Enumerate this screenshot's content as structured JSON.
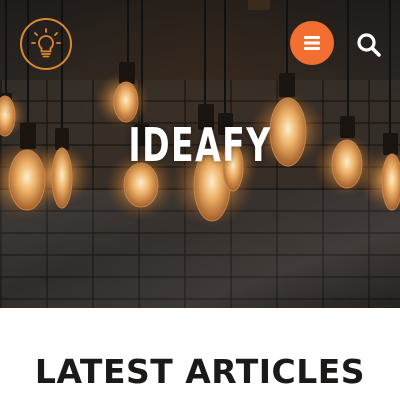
{
  "header": {
    "logo_icon": "lightbulb-icon",
    "menu_icon": "hamburger-menu-icon",
    "search_icon": "search-icon",
    "accent_color": "#f26f31",
    "logo_color": "#d8892f"
  },
  "hero": {
    "site_title": "IDEAFY"
  },
  "main": {
    "section_heading": "LATEST ARTICLES"
  }
}
